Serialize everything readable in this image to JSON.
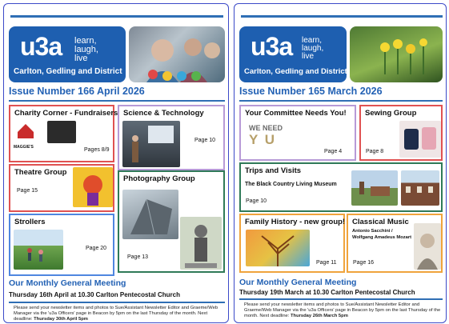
{
  "left": {
    "logo": {
      "mark": "u3a",
      "tag": [
        "learn,",
        "laugh,",
        "live"
      ],
      "subtitle": "Carlton, Gedling and District"
    },
    "issue": "Issue Number 166  April 2026",
    "tiles": {
      "charity": {
        "title": "Charity Corner - Fundraisers",
        "page": "Pages 8/9",
        "logo_text": "MAGGIE'S"
      },
      "science": {
        "title": "Science & Technology",
        "page": "Page 10"
      },
      "theatre": {
        "title": "Theatre Group",
        "page": "Page 15"
      },
      "photography": {
        "title": "Photography Group",
        "page": "Page 13"
      },
      "strollers": {
        "title": "Strollers",
        "page": "Page 20"
      }
    },
    "meeting": {
      "title": "Our Monthly General Meeting",
      "line": "Thursday 16th April at 10.30 Carlton Pentecostal Church"
    },
    "footnote": {
      "text": "Please send your newsletter items and photos to Sue/Assistant Newsletter Editor and Graeme/Web Manager via the 'u3a Officers' page in Beacon by 5pm on the last Thursday of the month. Next deadline: ",
      "deadline": "Thursday 30th April 5pm"
    }
  },
  "right": {
    "logo": {
      "mark": "u3a",
      "tag": [
        "learn,",
        "laugh,",
        "live"
      ],
      "subtitle": "Carlton, Gedling and District"
    },
    "issue": "Issue Number 165  March 2026",
    "tiles": {
      "committee": {
        "title": "Your Committee Needs You!",
        "page": "Page 4",
        "art_line1": "WE NEED",
        "art_line2": "Y U"
      },
      "sewing": {
        "title": "Sewing Group",
        "page": "Page 8"
      },
      "trips": {
        "title": "Trips and Visits",
        "subtitle": "The Black Country Living Museum",
        "page": "Page 10"
      },
      "family": {
        "title": "Family History - new group!",
        "page": "Page 11"
      },
      "classical": {
        "title": "Classical Music",
        "subtitle1": "Antonio Sacchini /",
        "subtitle2": "Wolfgang Amadeus Mozart",
        "page": "Page 16"
      }
    },
    "meeting": {
      "title": "Our Monthly General Meeting",
      "line": "Thursday 19th March at 10.30 Carlton Pentecostal Church"
    },
    "footnote": {
      "text": "Please send your newsletter items and photos to Sue/Assistant Newsletter Editor and Graeme/Web Manager via the 'u3a Officers' page in Beacon by 5pm on the last Thursday of the month. Next deadline: ",
      "deadline": "Thursday 26th March 5pm"
    }
  }
}
